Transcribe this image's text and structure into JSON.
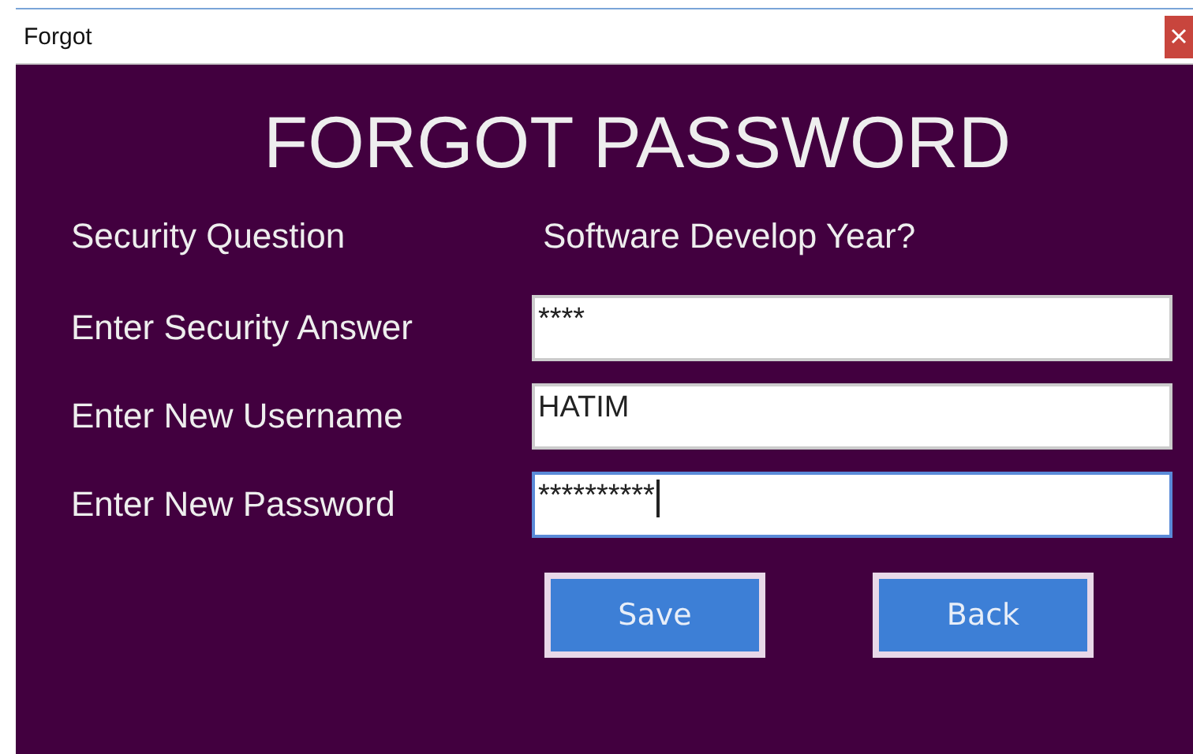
{
  "window": {
    "title": "Forgot"
  },
  "heading": "FORGOT PASSWORD",
  "security_question": {
    "label": "Security Question",
    "value": "Software Develop Year?"
  },
  "fields": [
    {
      "label": "Enter Security Answer",
      "value": "****",
      "focused": false
    },
    {
      "label": "Enter New Username",
      "value": "HATIM",
      "focused": false
    },
    {
      "label": "Enter New Password",
      "value": "**********",
      "focused": true
    }
  ],
  "buttons": [
    "Save",
    "Back"
  ]
}
